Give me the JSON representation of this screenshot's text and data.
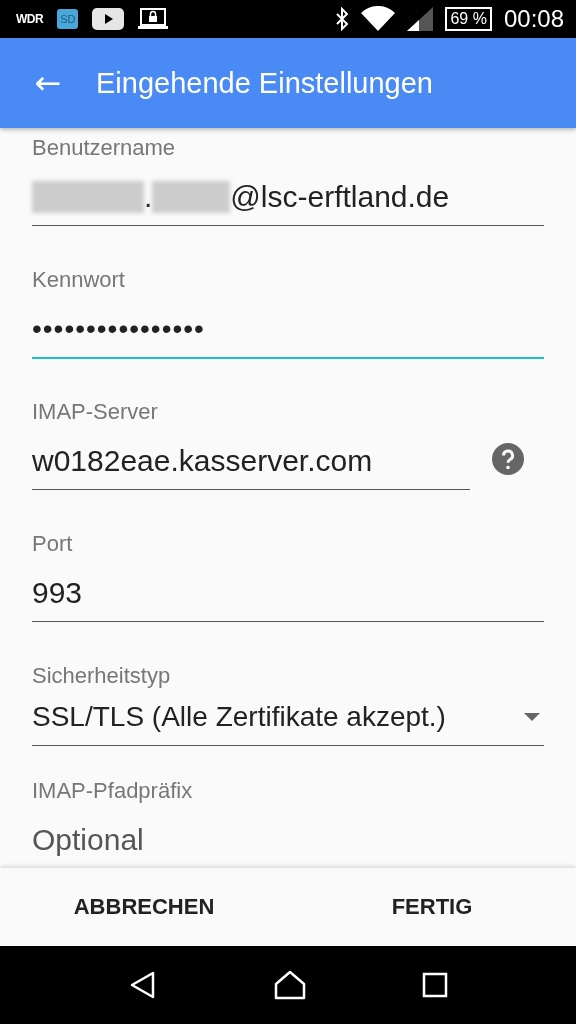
{
  "status_bar": {
    "left_labels": [
      "WDR",
      "SD"
    ],
    "battery": "69 %",
    "time": "00:08"
  },
  "app_bar": {
    "back": "←",
    "title": "Eingehende Einstellungen"
  },
  "fields": [
    {
      "kind": "text",
      "label": "Benutzername",
      "value_parts": [
        {
          "kind": "blurred"
        },
        {
          "kind": "text",
          "text": "."
        },
        {
          "kind": "blurred"
        },
        {
          "kind": "text",
          "text": "@lsc-erftland.de"
        }
      ],
      "focused": false
    },
    {
      "kind": "password",
      "label": "Kennwort",
      "value": "••••••••••••••••",
      "focused": true
    },
    {
      "kind": "help",
      "label": "IMAP-Server",
      "value": "w0182eae.kasserver.com",
      "focused": false
    },
    {
      "kind": "text",
      "label": "Port",
      "value": "993",
      "focused": false
    },
    {
      "kind": "dropdown",
      "label": "Sicherheitstyp",
      "value": "SSL/TLS (Alle Zertifikate akzept.)",
      "focused": false
    },
    {
      "kind": "text",
      "label": "IMAP-Pfadpräfix",
      "placeholder": "Optional",
      "focused": false
    }
  ],
  "buttons": [
    "ABBRECHEN",
    "FERTIG"
  ]
}
